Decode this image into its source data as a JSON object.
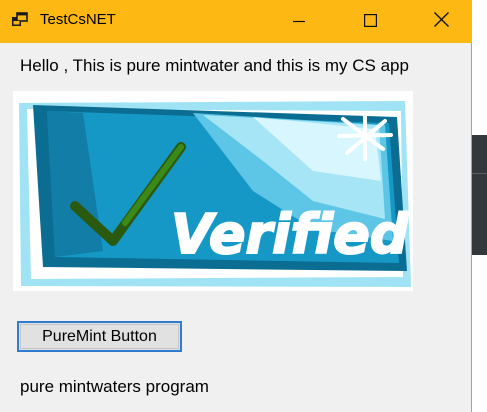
{
  "window": {
    "title": "TestCsNET",
    "titlebar_color": "#fdb813",
    "controls": [
      "minimize-icon",
      "maximize-icon",
      "close-icon"
    ]
  },
  "content": {
    "greeting": "Hello , This is pure mintwater and this is my CS app",
    "picture_text": "Verified",
    "button_label": "PureMint Button",
    "footer_label": "pure mintwaters program"
  },
  "colors": {
    "button_border": "#2e7bd0",
    "button_face": "#e1e1e1",
    "picture_blue": "#1097c8",
    "checkmark_green": "#2e6e12"
  }
}
